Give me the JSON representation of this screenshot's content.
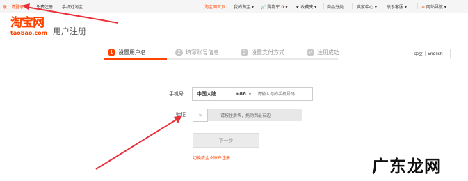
{
  "topbar": {
    "login_link": "录，请登录",
    "register_link": "免费注册",
    "mobile_link": "手机逛淘宝",
    "home_link": "淘宝网首页",
    "my_taobao": "我的淘宝",
    "cart": "购物车",
    "cart_count": "0",
    "favorites": "收藏夹",
    "categories": "商品分类",
    "seller_center": "卖家中心",
    "contact": "联系客服",
    "sitemap": "网站导航"
  },
  "logo": {
    "cn": "淘宝网",
    "en": "taobao.com",
    "page_title": "用户注册"
  },
  "steps": [
    {
      "num": "1",
      "label": "设置用户名"
    },
    {
      "num": "2",
      "label": "填写账号信息"
    },
    {
      "num": "3",
      "label": "设置支付方式"
    },
    {
      "num": "✓",
      "label": "注册成功"
    }
  ],
  "language": {
    "zh": "中文",
    "en": "English"
  },
  "form": {
    "phone_label": "手机号",
    "country": "中国大陆",
    "country_code": "+86",
    "phone_placeholder": "请输入你的手机号码",
    "verify_label": "验证",
    "slider_text": "请按住滑块，拖动到最右边",
    "next_button": "下一步",
    "enterprise_link": "切换成企业账户注册"
  },
  "watermark": "广东龙网",
  "colors": {
    "accent": "#ff4400",
    "annotation_arrow": "#e8303a"
  }
}
